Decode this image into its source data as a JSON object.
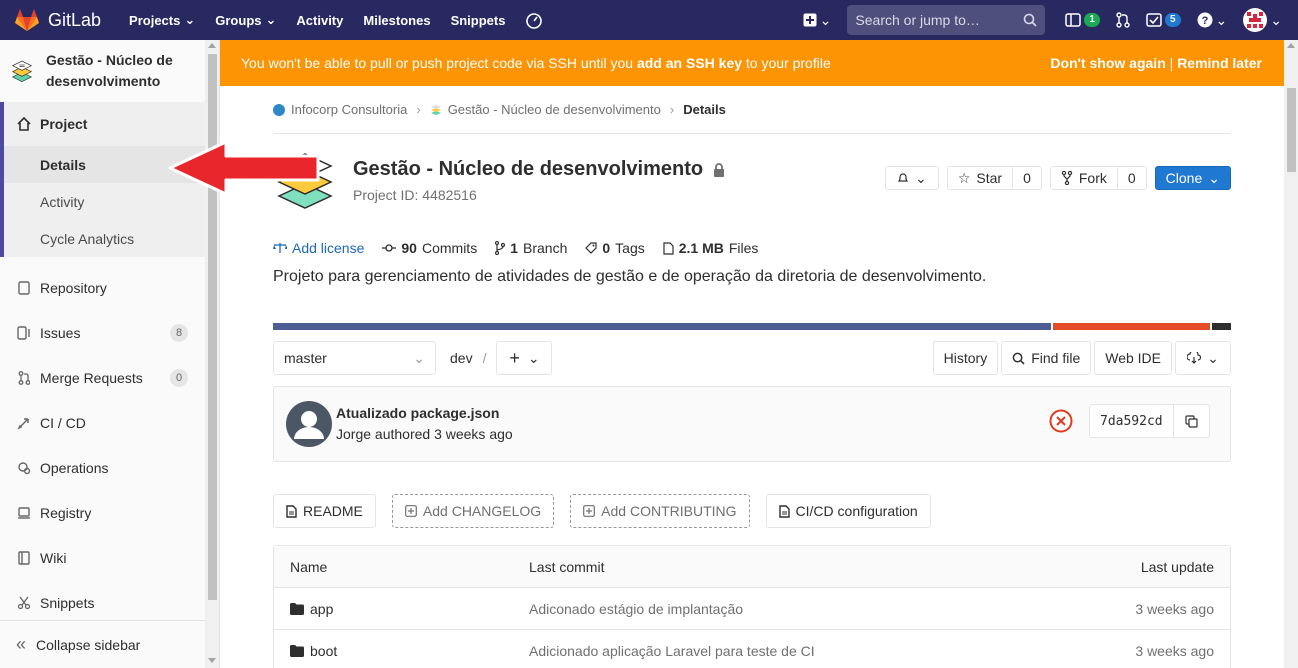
{
  "navbar": {
    "brand": "GitLab",
    "links": [
      {
        "label": "Projects",
        "dropdown": true
      },
      {
        "label": "Groups",
        "dropdown": true
      },
      {
        "label": "Activity",
        "dropdown": false
      },
      {
        "label": "Milestones",
        "dropdown": false
      },
      {
        "label": "Snippets",
        "dropdown": false
      }
    ],
    "search_placeholder": "Search or jump to…",
    "issues_count": "1",
    "todos_count": "5"
  },
  "sidebar": {
    "project_title": "Gestão - Núcleo de desenvolvimento",
    "project_label": "Project",
    "project_sub": [
      "Details",
      "Activity",
      "Cycle Analytics"
    ],
    "items": [
      {
        "label": "Repository",
        "icon": "doc-icon"
      },
      {
        "label": "Issues",
        "icon": "issues-icon",
        "count": "8"
      },
      {
        "label": "Merge Requests",
        "icon": "merge-icon",
        "count": "0"
      },
      {
        "label": "CI / CD",
        "icon": "rocket-icon"
      },
      {
        "label": "Operations",
        "icon": "cloud-gear-icon"
      },
      {
        "label": "Registry",
        "icon": "registry-icon"
      },
      {
        "label": "Wiki",
        "icon": "book-icon"
      },
      {
        "label": "Snippets",
        "icon": "scissors-icon"
      }
    ],
    "collapse_label": "Collapse sidebar"
  },
  "alert": {
    "text_before": "You won't be able to pull or push project code via SSH until you ",
    "link": "add an SSH key",
    "text_after": " to your profile",
    "dont_show": "Don't show again",
    "separator": "|",
    "remind": "Remind later"
  },
  "breadcrumb": [
    "Infocorp Consultoria",
    "Gestão - Núcleo de desenvolvimento",
    "Details"
  ],
  "project": {
    "name": "Gestão - Núcleo de desenvolvimento",
    "id_label": "Project ID: 4482516",
    "star_label": "Star",
    "star_count": "0",
    "fork_label": "Fork",
    "fork_count": "0",
    "clone_label": "Clone",
    "add_license": "Add license",
    "commits_num": "90",
    "commits_label": "Commits",
    "branch_num": "1",
    "branch_label": "Branch",
    "tags_num": "0",
    "tags_label": "Tags",
    "files_size": "2.1 MB",
    "files_label": "Files",
    "description": "Projeto para gerenciamento de atividades de gestão e de operação da diretoria de desenvolvimento."
  },
  "languages": [
    {
      "fraction": 0.815,
      "color": "#4f5d95"
    },
    {
      "fraction": 0.165,
      "color": "#e34c26"
    },
    {
      "fraction": 0.02,
      "color": "#2e2e2e"
    }
  ],
  "repo": {
    "branch": "master",
    "path": "dev",
    "path_sep": "/",
    "history": "History",
    "find_file": "Find file",
    "web_ide": "Web IDE"
  },
  "commit": {
    "title": "Atualizado package.json",
    "meta": "Jorge authored 3 weeks ago",
    "sha": "7da592cd",
    "status": "failed"
  },
  "docs": [
    {
      "label": "README",
      "dashed": false,
      "icon": "file-icon"
    },
    {
      "label": "Add CHANGELOG",
      "dashed": true,
      "icon": "plus-square-icon"
    },
    {
      "label": "Add CONTRIBUTING",
      "dashed": true,
      "icon": "plus-square-icon"
    },
    {
      "label": "CI/CD configuration",
      "dashed": false,
      "icon": "file-icon"
    }
  ],
  "tree": {
    "headers": {
      "name": "Name",
      "commit": "Last commit",
      "update": "Last update"
    },
    "rows": [
      {
        "name": "app",
        "commit": "Adiconado estágio de implantação",
        "update": "3 weeks ago"
      },
      {
        "name": "boot",
        "commit": "Adicionado aplicação Laravel para teste de CI",
        "update": "3 weeks ago"
      }
    ]
  },
  "colors": {
    "navbar": "#292961",
    "alert": "#fc9403",
    "primary": "#1f78d1",
    "annotation_arrow": "#e8262b"
  }
}
